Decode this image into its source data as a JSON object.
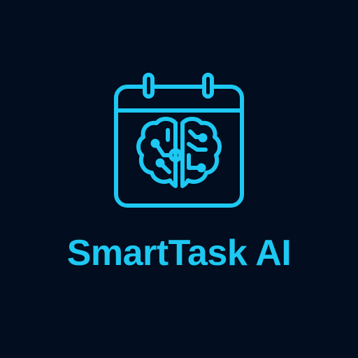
{
  "brand": {
    "name": "SmartTask AI",
    "accent_color": "#1dc8f2",
    "background_color": "#020d1f"
  },
  "logo": {
    "icon": "calendar-brain-icon"
  }
}
